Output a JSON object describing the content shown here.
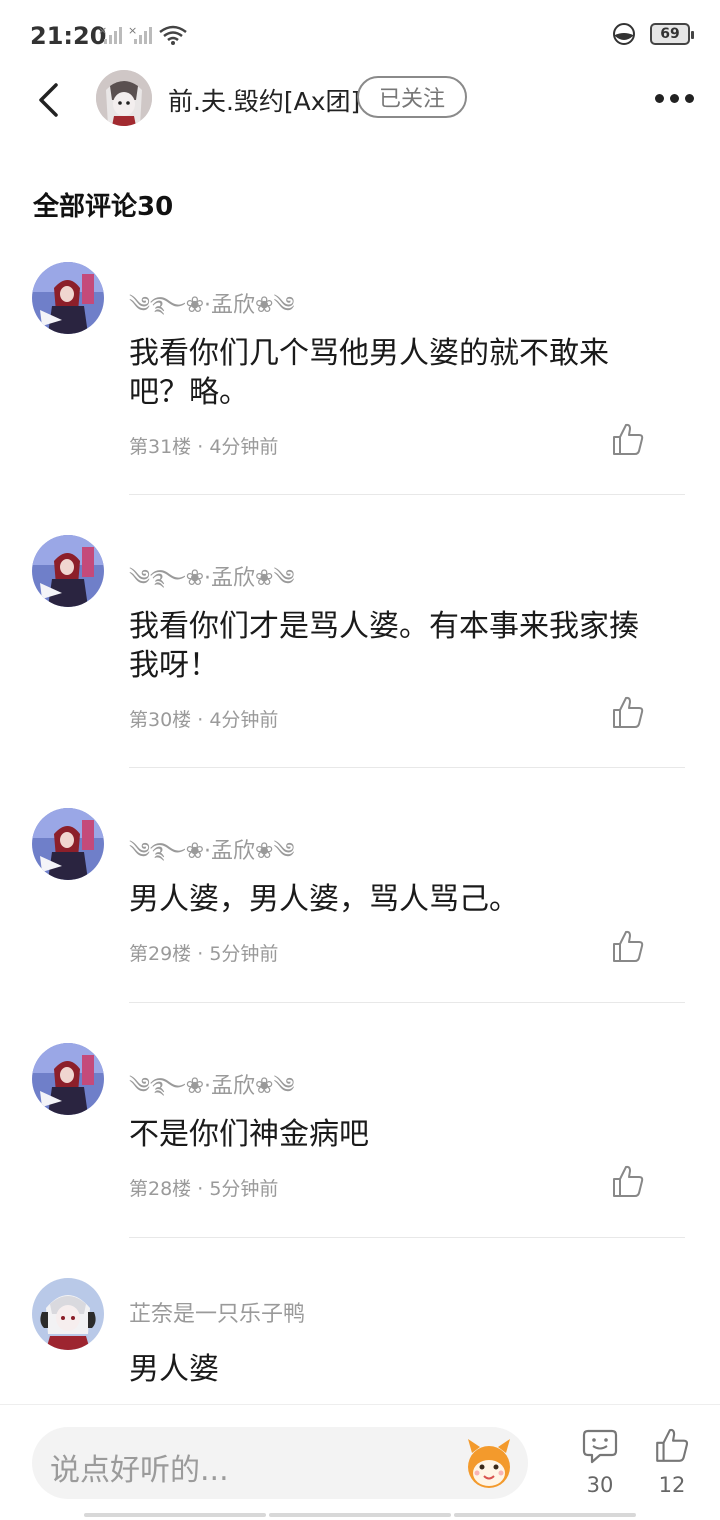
{
  "status_bar": {
    "time": "21:20",
    "battery": "69",
    "icons": [
      "signal-x-icon",
      "signal-x-icon",
      "wifi-icon",
      "dnd-icon",
      "battery-icon"
    ]
  },
  "header": {
    "back_icon": "chevron-left-icon",
    "name": "前.夫.毁约[Ax团]",
    "follow_label": "已关注",
    "more_icon": "more-dots-icon"
  },
  "section_title": "全部评论30",
  "comments": [
    {
      "user": "༄࿐❀·孟欣❀༄",
      "text": "我看你们几个骂他男人婆的就不敢来吧？略。",
      "floor": "第31楼",
      "time": "4分钟前"
    },
    {
      "user": "༄࿐❀·孟欣❀༄",
      "text": "我看你们才是骂人婆。有本事来我家揍我呀！",
      "floor": "第30楼",
      "time": "4分钟前"
    },
    {
      "user": "༄࿐❀·孟欣❀༄",
      "text": "男人婆，男人婆，骂人骂己。",
      "floor": "第29楼",
      "time": "5分钟前"
    },
    {
      "user": "༄࿐❀·孟欣❀༄",
      "text": "不是你们神金病吧",
      "floor": "第28楼",
      "time": "5分钟前"
    },
    {
      "user": "芷奈是一只乐子鸭",
      "text": "男人婆",
      "floor": "",
      "time": ""
    }
  ],
  "meta_separator": "·",
  "bottom_bar": {
    "input_placeholder": "说点好听的...",
    "comment_count": "30",
    "like_count": "12"
  },
  "colors": {
    "accent_text": "#222222",
    "muted_text": "#9a9a9a",
    "follow_border": "#8a8a8a",
    "emoji_orange": "#f39a2c"
  }
}
